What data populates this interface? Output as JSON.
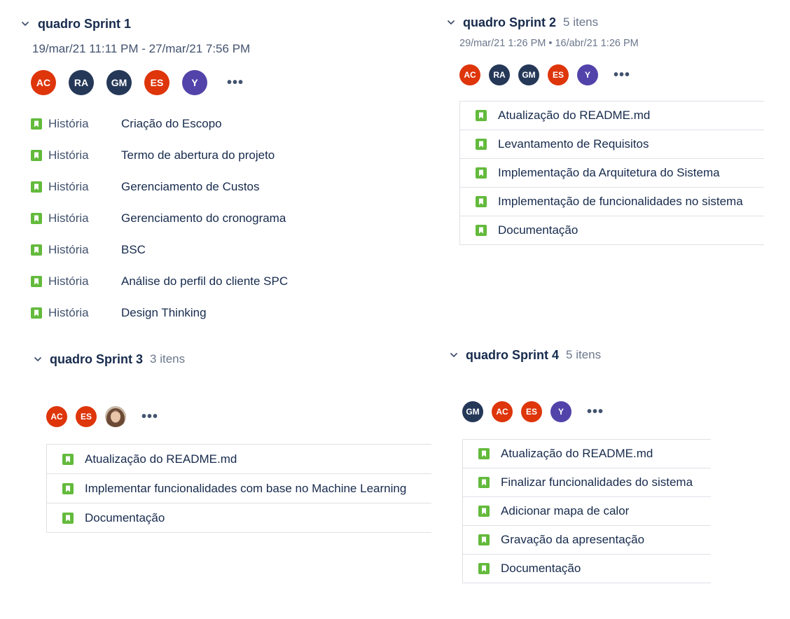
{
  "colors": {
    "ac": "#de350b",
    "es": "#de350b",
    "ra": "#253858",
    "gm": "#253858",
    "y": "#5243aa",
    "story_icon": "#63ba3c",
    "border": "#dfe1e6"
  },
  "sprint1": {
    "title": "quadro Sprint 1",
    "dates": "19/mar/21 11:11 PM - 27/mar/21 7:56 PM",
    "avatars": [
      "AC",
      "RA",
      "GM",
      "ES",
      "Y"
    ],
    "more": "•••",
    "issues": [
      {
        "type": "História",
        "summary": "Criação do Escopo",
        "icon": "story-icon"
      },
      {
        "type": "História",
        "summary": "Termo de abertura do projeto",
        "icon": "story-icon"
      },
      {
        "type": "História",
        "summary": "Gerenciamento de Custos",
        "icon": "story-icon"
      },
      {
        "type": "História",
        "summary": "Gerenciamento do cronograma",
        "icon": "story-icon"
      },
      {
        "type": "História",
        "summary": "BSC",
        "icon": "story-icon"
      },
      {
        "type": "História",
        "summary": "Análise do perfil do cliente SPC",
        "icon": "story-icon"
      },
      {
        "type": "História",
        "summary": "Design Thinking",
        "icon": "story-icon"
      }
    ]
  },
  "sprint2": {
    "title": "quadro Sprint 2",
    "count": "5 itens",
    "dates": "29/mar/21 1:26 PM • 16/abr/21 1:26 PM",
    "avatars": [
      "AC",
      "RA",
      "GM",
      "ES",
      "Y"
    ],
    "more": "•••",
    "issues": [
      "Atualização do README.md",
      "Levantamento de Requisitos",
      "Implementação da Arquitetura do Sistema",
      "Implementação de funcionalidades no sistema",
      "Documentação"
    ]
  },
  "sprint3": {
    "title": "quadro Sprint 3",
    "count": "3 itens",
    "avatars": [
      "AC",
      "ES",
      "photo"
    ],
    "more": "•••",
    "issues": [
      "Atualização do README.md",
      "Implementar funcionalidades com base no Machine Learning",
      "Documentação"
    ]
  },
  "sprint4": {
    "title": "quadro Sprint 4",
    "count": "5 itens",
    "avatars": [
      "GM",
      "AC",
      "ES",
      "Y"
    ],
    "more": "•••",
    "issues": [
      "Atualização do README.md",
      "Finalizar funcionalidades do sistema",
      "Adicionar mapa de calor",
      "Gravação da apresentação",
      "Documentação"
    ]
  }
}
